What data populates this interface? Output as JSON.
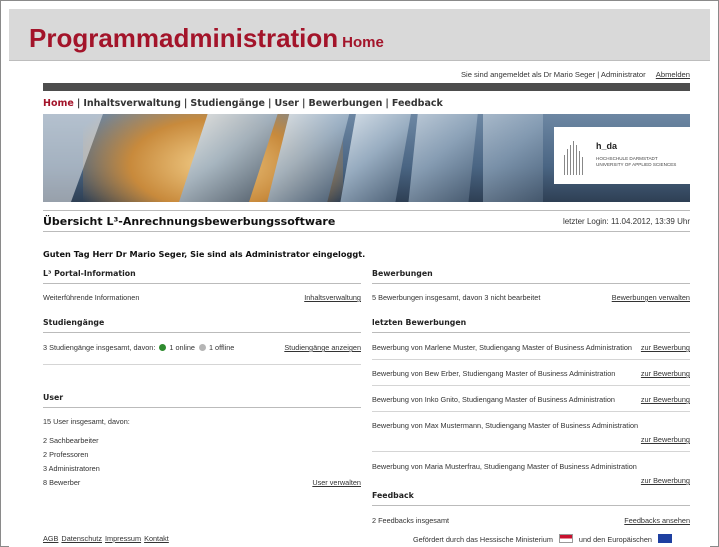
{
  "header": {
    "title": "Programmadministration",
    "subtitle": "Home"
  },
  "userbar": {
    "text": "Sie sind angemeldet als Dr Mario Seger | Administrator",
    "logout": "Abmelden"
  },
  "nav": {
    "items": [
      "Home",
      "Inhaltsverwaltung",
      "Studiengänge",
      "User",
      "Bewerbungen",
      "Feedback"
    ],
    "separator": "|"
  },
  "logo": {
    "name": "h_da",
    "line1": "HOCHSCHULE DARMSTADT",
    "line2": "UNIVERSITY OF APPLIED SCIENCES"
  },
  "overview": {
    "title": "Übersicht L³-Anrechnungsbewerbungssoftware",
    "last_login": "letzter Login: 11.04.2012, 13:39 Uhr"
  },
  "greeting": "Guten Tag Herr Dr Mario Seger, Sie sind als Administrator eingeloggt.",
  "left": {
    "portal": {
      "title": "L³ Portal-Information",
      "text": "Weiterführende Informationen",
      "link": "Inhaltsverwaltung"
    },
    "studies": {
      "title": "Studiengänge",
      "text": "3 Studiengänge insgesamt, davon:",
      "online": "1 online",
      "offline": "1 offline",
      "link": "Studiengänge anzeigen",
      "online_color": "#2e8b2e",
      "offline_color": "#b5b5b5"
    },
    "users": {
      "title": "User",
      "summary": "15 User insgesamt, davon:",
      "roles": [
        "2 Sachbearbeiter",
        "2 Professoren",
        "3 Administratoren",
        "8 Bewerber"
      ],
      "link": "User verwalten"
    }
  },
  "right": {
    "applications": {
      "title": "Bewerbungen",
      "text": "5 Bewerbungen insgesamt, davon 3 nicht bearbeitet",
      "link": "Bewerbungen verwalten"
    },
    "latest": {
      "title": "letzten Bewerbungen",
      "items": [
        {
          "text": "Bewerbung von Marlene Muster, Studiengang Master of Business Administration",
          "link": "zur Bewerbung"
        },
        {
          "text": "Bewerbung von Bew Erber, Studiengang Master of Business Administration",
          "link": "zur Bewerbung"
        },
        {
          "text": "Bewerbung von Inko Gnito, Studiengang Master of Business Administration",
          "link": "zur Bewerbung"
        },
        {
          "text": "Bewerbung von Max Mustermann, Studiengang Master of Business Administration",
          "link": "zur Bewerbung"
        },
        {
          "text": "Bewerbung von Maria Musterfrau, Studiengang Master of Business Administration",
          "link": "zur Bewerbung"
        }
      ]
    },
    "feedback": {
      "title": "Feedback",
      "text": "2 Feedbacks insgesamt",
      "link": "Feedbacks ansehen"
    }
  },
  "footer": {
    "links": [
      "AGB",
      "Datenschutz",
      "Impressum",
      "Kontakt"
    ],
    "sponsor": "Gefördert durch das Hessische Ministerium",
    "sponsor2": "und den Europäischen"
  },
  "colors": {
    "accent": "#a3142a",
    "header_bg": "#d9d9d9",
    "dark_bar": "#4d4d4d"
  }
}
